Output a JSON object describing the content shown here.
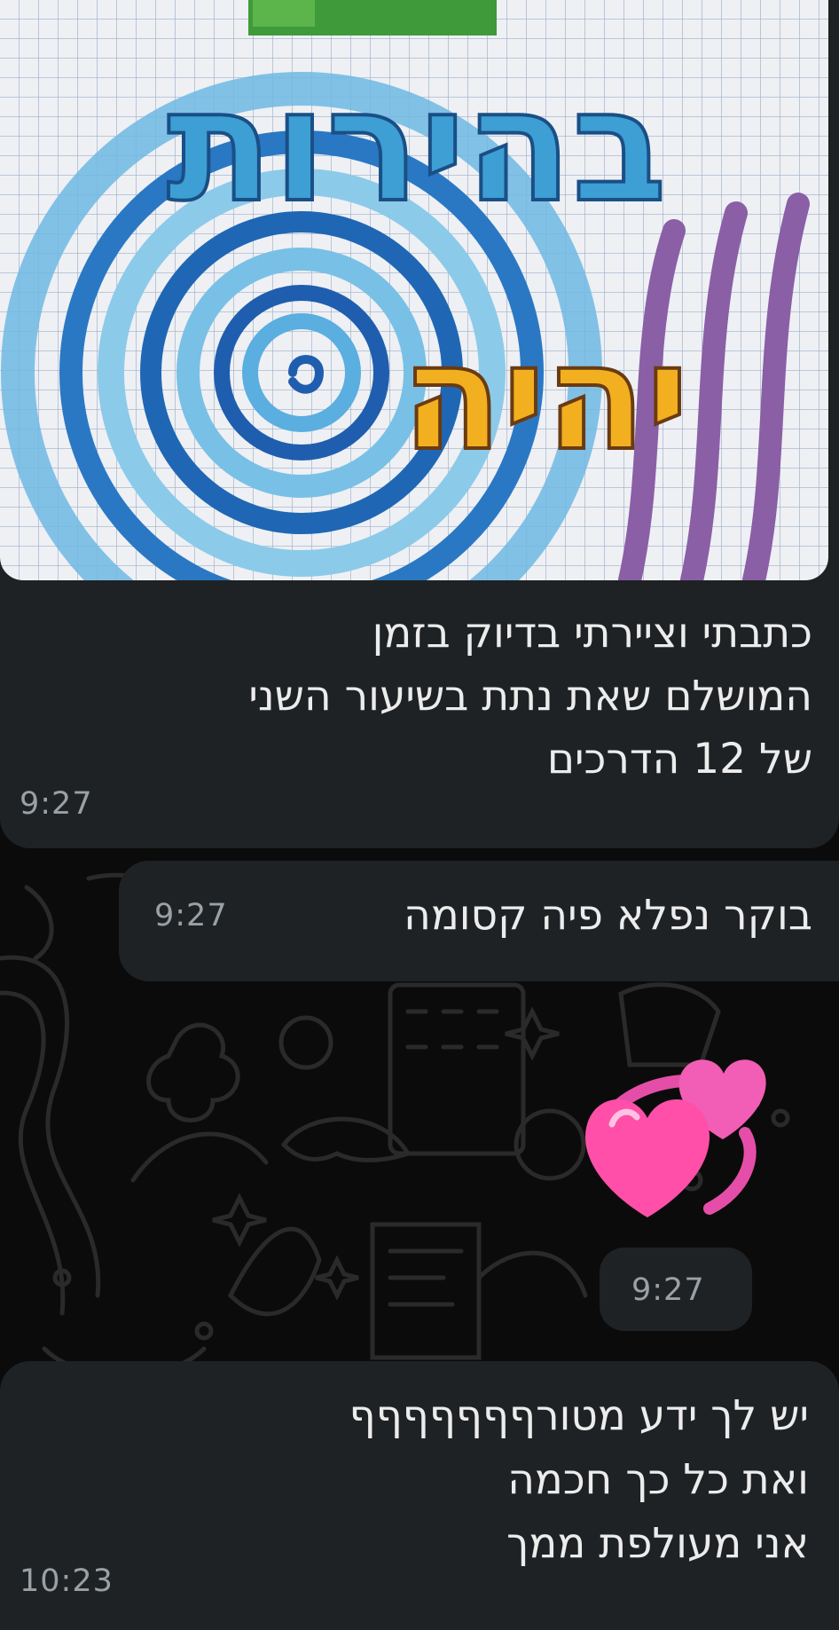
{
  "chat": {
    "background_color": "#0b0b0b",
    "bubble_color": "#1f2224",
    "text_color": "#ececec",
    "timestamp_color": "#9aa0a4",
    "messages": [
      {
        "kind": "image",
        "image_text_line1": "בהירות",
        "image_text_line2": "יהיה",
        "caption_lines": [
          "כתבתי וציירתי בדיוק בזמן",
          "המושלם שאת נתת בשיעור השני",
          "של 12 הדרכים"
        ],
        "time": "9:27"
      },
      {
        "kind": "text",
        "text": "בוקר נפלא פיה קסומה",
        "time": "9:27"
      },
      {
        "kind": "emoji",
        "emoji": "revolving-hearts-emoji",
        "time": "9:27"
      },
      {
        "kind": "text",
        "lines": [
          "יש לך ידע מטורףףףףףףף",
          "ואת כל כך חכמה",
          "אני מעולפת ממך"
        ],
        "time": "10:23"
      }
    ]
  }
}
